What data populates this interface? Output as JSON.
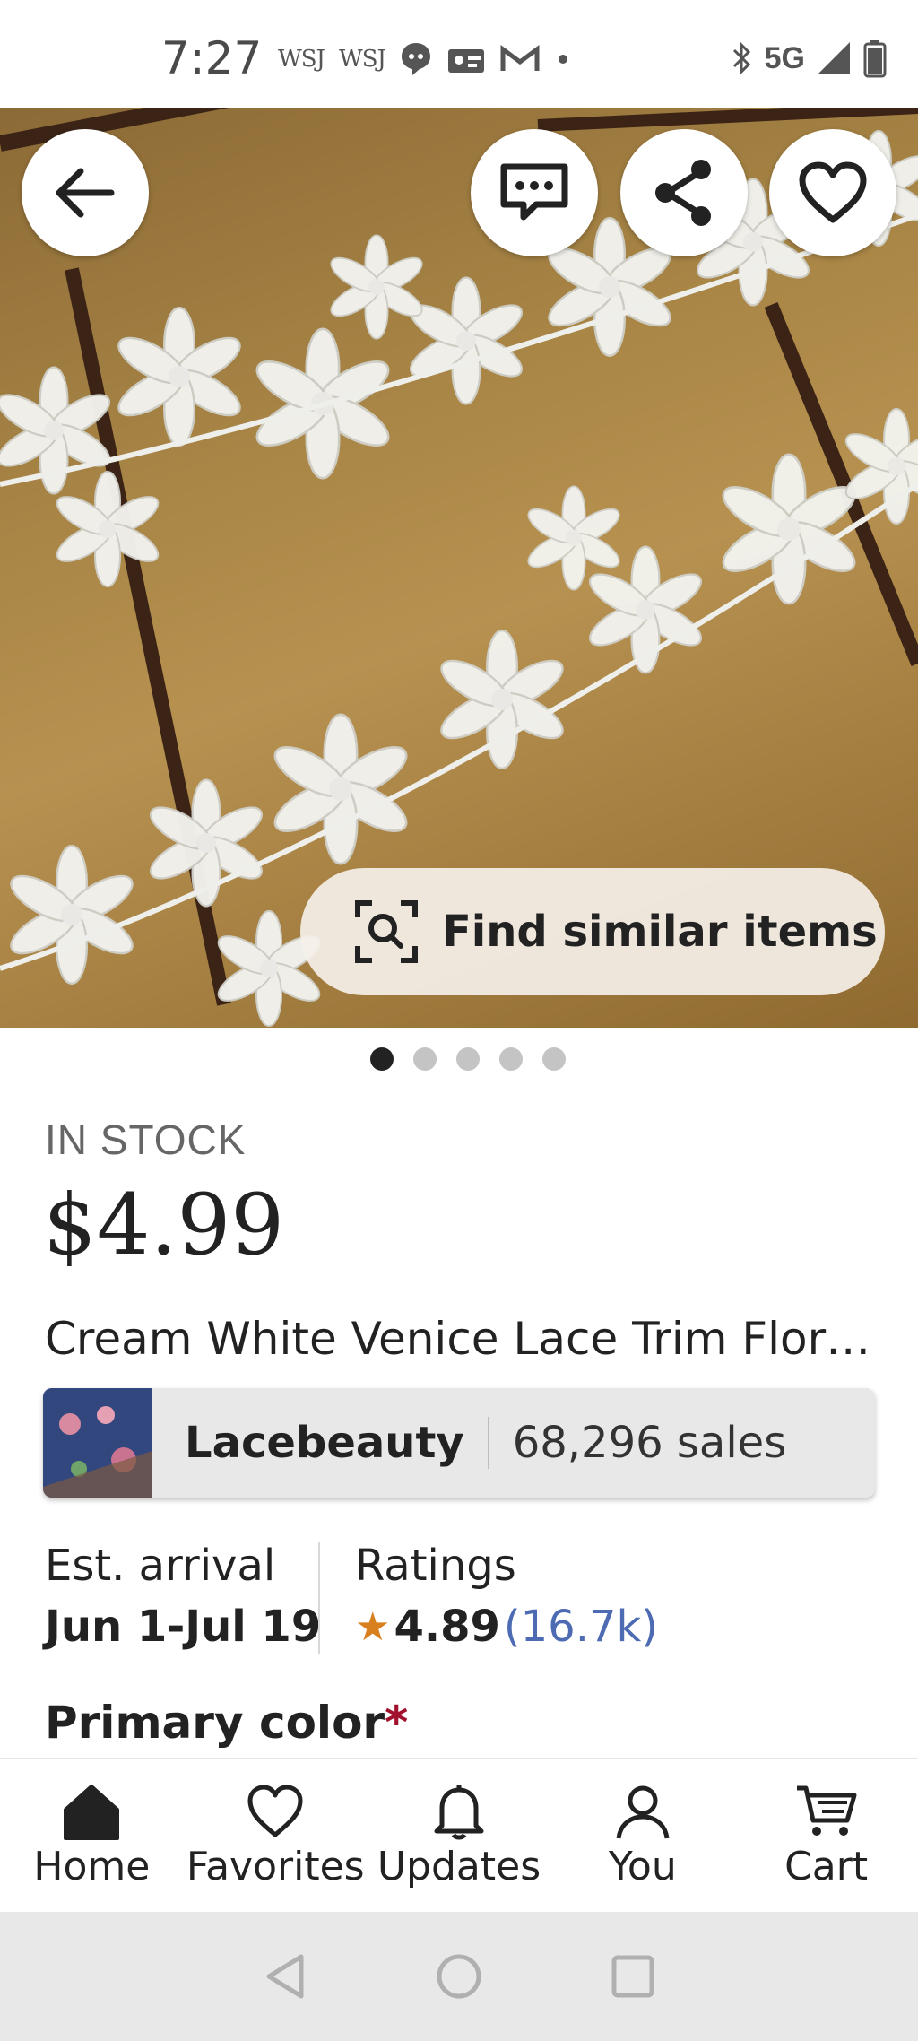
{
  "status_bar": {
    "time": "7:27",
    "notif_wsj_1": "WSJ",
    "notif_wsj_2": "WSJ",
    "network": "5G"
  },
  "hero": {
    "find_similar_label": "Find similar items",
    "image_count": 5,
    "active_image_index": 0
  },
  "product": {
    "stock_status": "IN STOCK",
    "price": "$4.99",
    "title": "Cream White Venice Lace Trim Flora..."
  },
  "shop": {
    "name": "Lacebeauty",
    "sales": "68,296 sales"
  },
  "delivery": {
    "label": "Est. arrival",
    "value": "Jun 1-Jul 19"
  },
  "ratings": {
    "label": "Ratings",
    "value": "4.89",
    "count": "(16.7k)"
  },
  "options": {
    "primary_color_label": "Primary color",
    "required_marker": "*"
  },
  "bottom_nav": {
    "home": "Home",
    "favorites": "Favorites",
    "updates": "Updates",
    "you": "You",
    "cart": "Cart"
  },
  "colors": {
    "rating_star": "#d9801e",
    "rating_count": "#4d6bb3",
    "required": "#a2112e",
    "active_dot": "#222222"
  }
}
